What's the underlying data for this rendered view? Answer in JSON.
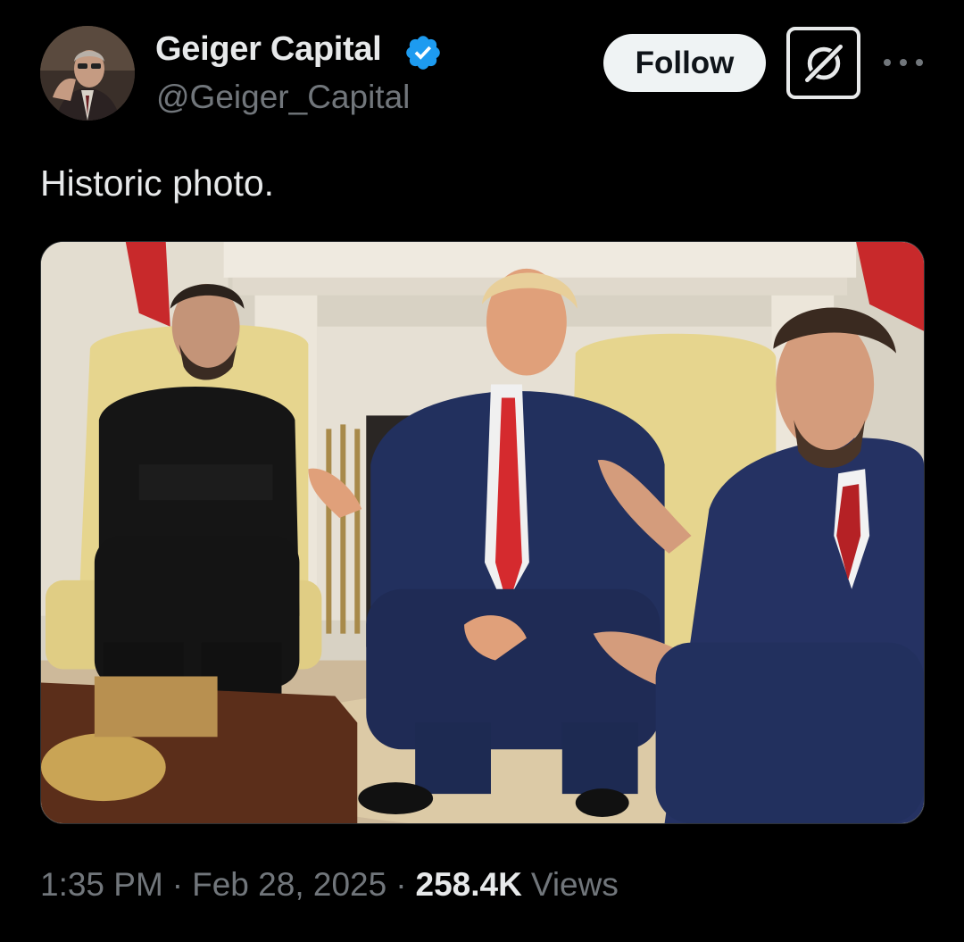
{
  "author": {
    "display_name": "Geiger Capital",
    "handle": "@Geiger_Capital",
    "verified": true,
    "avatar_icon": "avatar-photo",
    "verified_icon": "verified-badge-icon",
    "verified_color": "#1d9bf0"
  },
  "actions": {
    "follow_label": "Follow",
    "grok_icon": "grok-icon",
    "more_icon": "more-dots-icon"
  },
  "post": {
    "text": "Historic photo.",
    "media_icon": "post-photo"
  },
  "meta": {
    "time": "1:35 PM",
    "separator": "·",
    "date": "Feb 28, 2025",
    "views_count": "258.4K",
    "views_label": "Views"
  },
  "colors": {
    "background": "#000000",
    "primary_text": "#e7e9ea",
    "secondary_text": "#71767b",
    "follow_bg": "#eff3f4"
  }
}
